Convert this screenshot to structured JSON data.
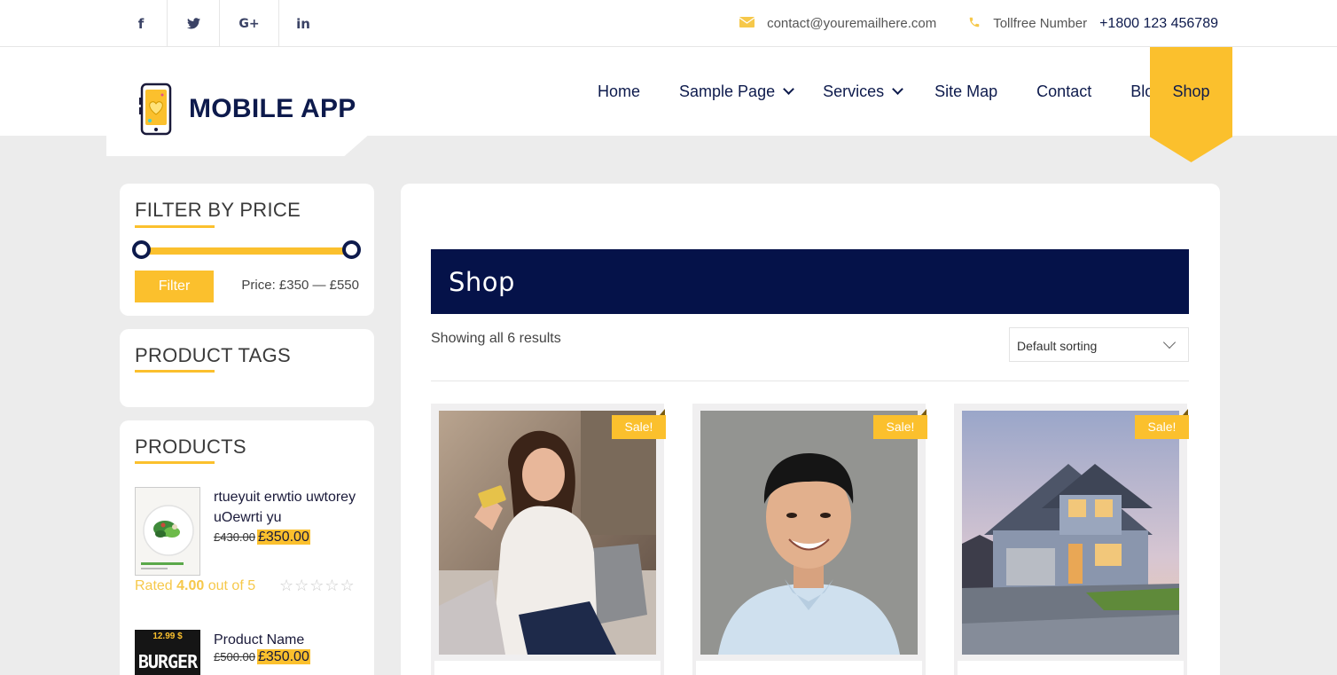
{
  "topbar": {
    "social": [
      {
        "name": "facebook-icon",
        "glyph": "f"
      },
      {
        "name": "twitter-icon",
        "glyph": "🐦"
      },
      {
        "name": "google-plus-icon",
        "glyph": "G+"
      },
      {
        "name": "linkedin-icon",
        "glyph": "in"
      }
    ],
    "email": "contact@youremailhere.com",
    "tollfree_label": "Tollfree Number",
    "tollfree_number": "+1800 123 456789"
  },
  "brand": {
    "name": "MOBILE APP",
    "accent": "#fbc02d",
    "navy": "#0d1a4c"
  },
  "nav": {
    "items": [
      {
        "label": "Home",
        "has_dropdown": false
      },
      {
        "label": "Sample Page",
        "has_dropdown": true
      },
      {
        "label": "Services",
        "has_dropdown": true
      },
      {
        "label": "Site Map",
        "has_dropdown": false
      },
      {
        "label": "Contact",
        "has_dropdown": false
      },
      {
        "label": "Blog",
        "has_dropdown": true
      }
    ],
    "active": "Shop"
  },
  "sidebar": {
    "filter": {
      "title": "FILTER BY PRICE",
      "button": "Filter",
      "price": "Price: £350 — £550"
    },
    "tags": {
      "title": "PRODUCT TAGS"
    },
    "products": {
      "title": "PRODUCTS",
      "items": [
        {
          "name_line1": "rtueyuit erwtio uwtorey",
          "name_line2": "uOewrti yu",
          "old_price": "£430.00",
          "new_price": "£350.00",
          "rating_prefix": "Rated ",
          "rating_value": "4.00",
          "rating_suffix": " out of 5",
          "stars": "☆☆☆☆☆"
        },
        {
          "name_line1": "Product Name",
          "old_price": "£500.00",
          "new_price": "£350.00",
          "image_text_price": "12.99 $",
          "image_text_title": "BURGER"
        }
      ]
    }
  },
  "main": {
    "heading": "Shop",
    "results": "Showing all 6 results",
    "sort": "Default sorting",
    "sale_badge": "Sale!",
    "cards": [
      {
        "name": "woman-shopping-photo"
      },
      {
        "name": "smiling-man-photo"
      },
      {
        "name": "house-photo"
      }
    ]
  }
}
